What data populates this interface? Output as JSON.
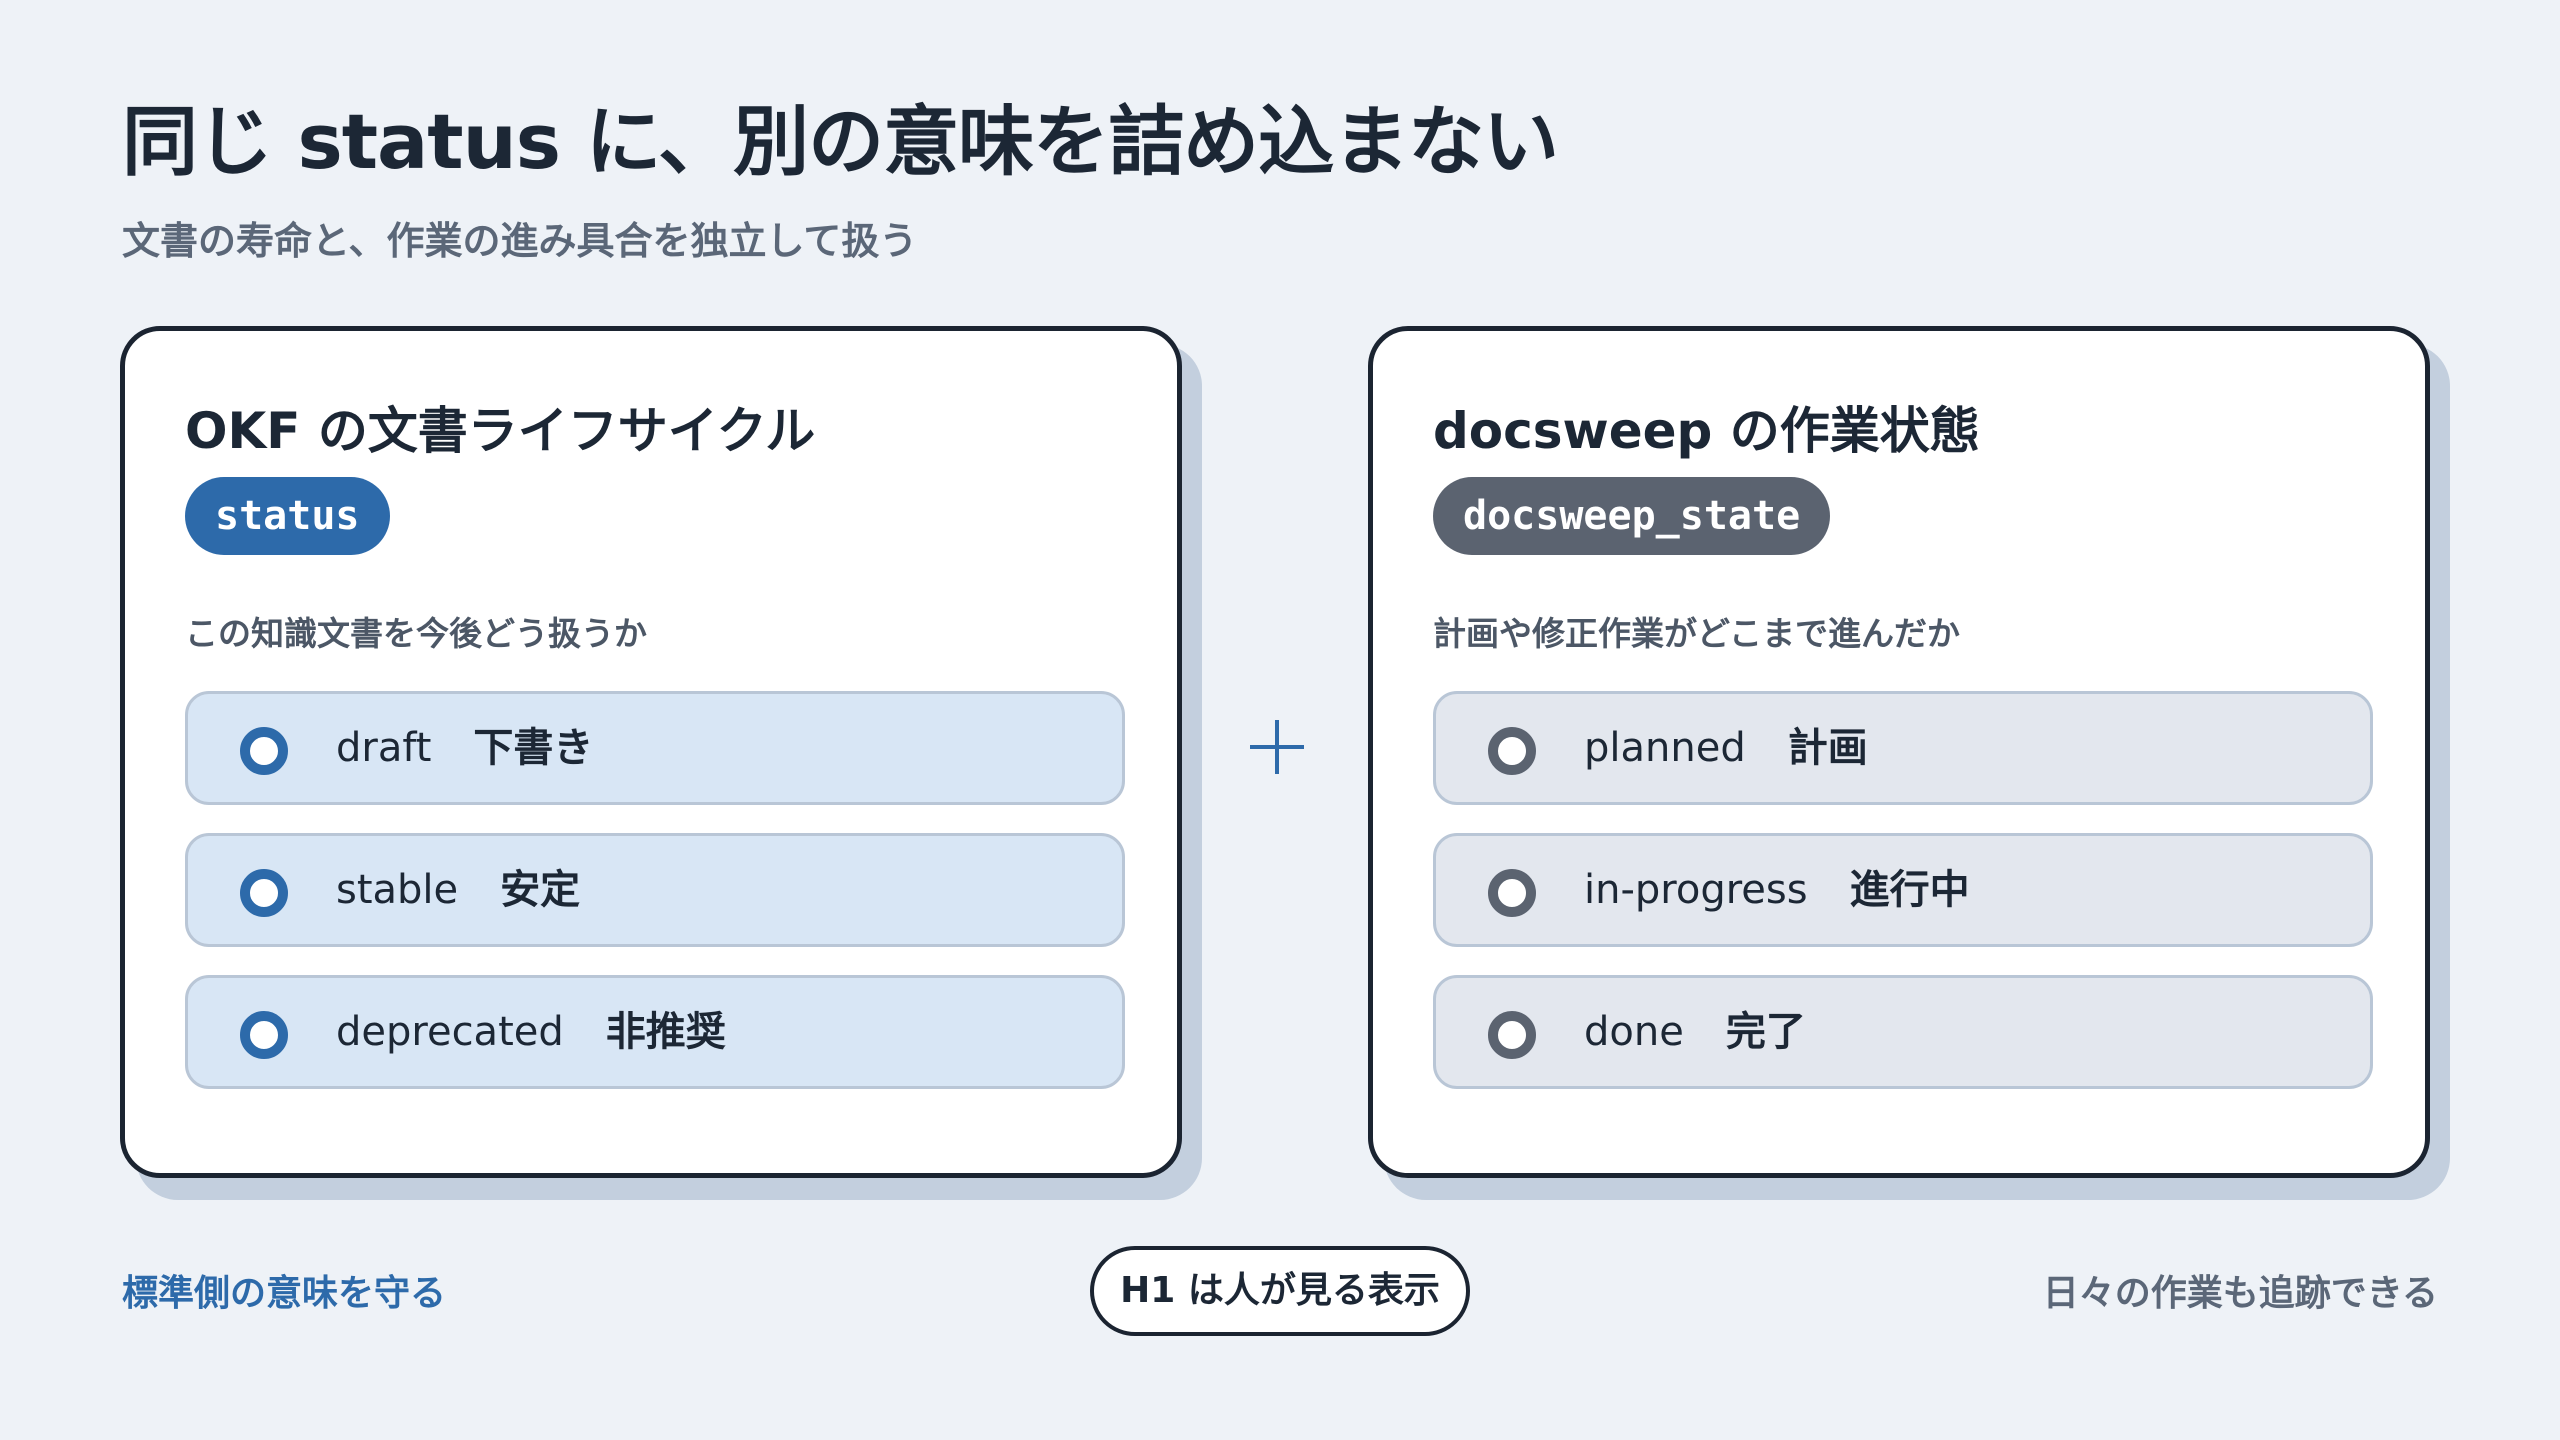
{
  "header": {
    "title": "同じ status に、別の意味を詰め込まない",
    "subtitle": "文書の寿命と、作業の進み具合を独立して扱う"
  },
  "left_card": {
    "title": "OKF の文書ライフサイクル",
    "field": "status",
    "description": "この知識文書を今後どう扱うか",
    "accent_color": "#2d6aaa",
    "option_bg": "#d8e6f5",
    "options": [
      {
        "value": "draft",
        "label": "下書き"
      },
      {
        "value": "stable",
        "label": "安定"
      },
      {
        "value": "deprecated",
        "label": "非推奨"
      }
    ]
  },
  "connector": {
    "icon": "plus-icon"
  },
  "right_card": {
    "title": "docsweep の作業状態",
    "field": "docsweep_state",
    "description": "計画や修正作業がどこまで進んだか",
    "accent_color": "#5b6370",
    "option_bg": "#e3e7ee",
    "options": [
      {
        "value": "planned",
        "label": "計画"
      },
      {
        "value": "in-progress",
        "label": "進行中"
      },
      {
        "value": "done",
        "label": "完了"
      }
    ]
  },
  "footer": {
    "left": "標準側の意味を守る",
    "center": "H1 は人が見る表示",
    "right": "日々の作業も追跡できる"
  }
}
